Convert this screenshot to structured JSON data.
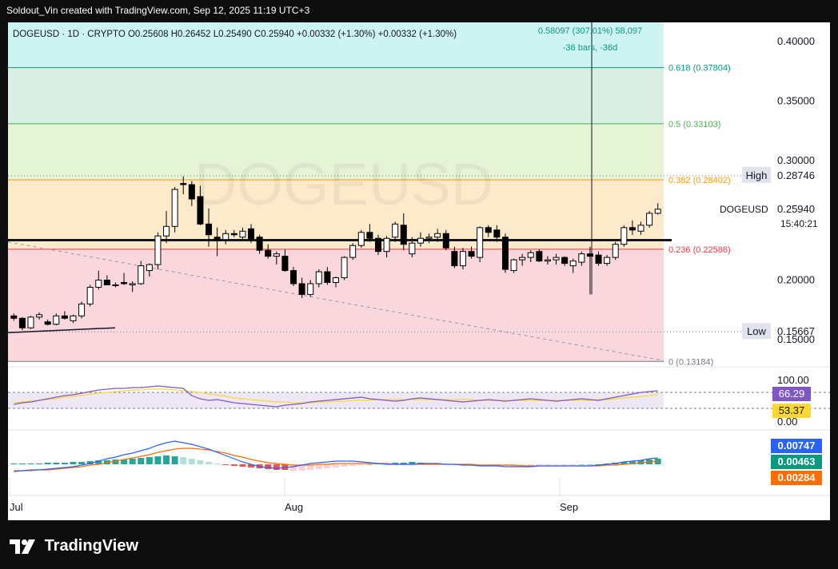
{
  "header": {
    "text": "Soldout_Vin created with TradingView.com, Sep 12, 2025 11:19 UTC+3"
  },
  "brand": {
    "text": "TradingView",
    "icon": "tradingview-logo-icon"
  },
  "chart_data": {
    "type": "candlestick",
    "symbol_line": "DOGEUSD · 1D · CRYPTO  O0.25608  H0.26452  L0.25490  C0.25940  +0.00332 (+1.30%)  +0.00332 (+1.30%)",
    "watermark": "DOGEUSD",
    "y_ticks": [
      "0.40000",
      "0.35000",
      "0.30000",
      "0.20000",
      "0.15000"
    ],
    "x_ticks": [
      "Jul",
      "Aug",
      "Sep"
    ],
    "ylim": [
      0.128,
      0.416
    ],
    "price_label": {
      "symbol": "DOGEUSD",
      "value": "0.25940",
      "countdown": "15:40:21"
    },
    "high_label": {
      "label": "High",
      "value": "0.28746"
    },
    "low_label": {
      "label": "Low",
      "value": "0.15667"
    },
    "measure": {
      "line1": "0.58097 (307.01%) 58,097",
      "line2": "-36 bars, -36d"
    },
    "fib_levels": [
      {
        "text": "0.618 (0.37804)",
        "price": 0.37804,
        "color": "#089981"
      },
      {
        "text": "0.5 (0.33103)",
        "price": 0.33103,
        "color": "#4caf50"
      },
      {
        "text": "0.382 (0.28402)",
        "price": 0.28402,
        "color": "#ff9800"
      },
      {
        "text": "0.236 (0.22586)",
        "price": 0.22586,
        "color": "#f23645"
      },
      {
        "text": "0 (0.13184)",
        "price": 0.13184,
        "color": "#787b86"
      }
    ],
    "candles": [
      [
        0.17,
        0.172,
        0.166,
        0.168
      ],
      [
        0.168,
        0.169,
        0.158,
        0.16
      ],
      [
        0.16,
        0.17,
        0.159,
        0.169
      ],
      [
        0.169,
        0.173,
        0.167,
        0.171
      ],
      [
        0.165,
        0.167,
        0.162,
        0.163
      ],
      [
        0.163,
        0.172,
        0.162,
        0.17
      ],
      [
        0.17,
        0.174,
        0.167,
        0.168
      ],
      [
        0.166,
        0.171,
        0.164,
        0.17
      ],
      [
        0.17,
        0.182,
        0.168,
        0.18
      ],
      [
        0.18,
        0.196,
        0.178,
        0.194
      ],
      [
        0.194,
        0.208,
        0.192,
        0.2
      ],
      [
        0.2,
        0.204,
        0.196,
        0.196
      ],
      [
        0.196,
        0.198,
        0.194,
        0.196
      ],
      [
        0.198,
        0.206,
        0.196,
        0.197
      ],
      [
        0.196,
        0.199,
        0.19,
        0.197
      ],
      [
        0.197,
        0.216,
        0.196,
        0.212
      ],
      [
        0.208,
        0.214,
        0.203,
        0.213
      ],
      [
        0.213,
        0.24,
        0.209,
        0.237
      ],
      [
        0.237,
        0.258,
        0.231,
        0.245
      ],
      [
        0.245,
        0.278,
        0.24,
        0.276
      ],
      [
        0.281,
        0.287,
        0.272,
        0.28
      ],
      [
        0.28,
        0.283,
        0.262,
        0.268
      ],
      [
        0.27,
        0.279,
        0.246,
        0.247
      ],
      [
        0.247,
        0.26,
        0.228,
        0.238
      ],
      [
        0.236,
        0.244,
        0.22,
        0.233
      ],
      [
        0.234,
        0.242,
        0.23,
        0.239
      ],
      [
        0.239,
        0.242,
        0.236,
        0.238
      ],
      [
        0.236,
        0.244,
        0.234,
        0.241
      ],
      [
        0.243,
        0.247,
        0.231,
        0.234
      ],
      [
        0.236,
        0.238,
        0.222,
        0.225
      ],
      [
        0.225,
        0.23,
        0.218,
        0.22
      ],
      [
        0.22,
        0.224,
        0.213,
        0.222
      ],
      [
        0.22,
        0.226,
        0.207,
        0.208
      ],
      [
        0.208,
        0.211,
        0.195,
        0.197
      ],
      [
        0.197,
        0.202,
        0.185,
        0.188
      ],
      [
        0.188,
        0.2,
        0.186,
        0.197
      ],
      [
        0.197,
        0.209,
        0.194,
        0.207
      ],
      [
        0.207,
        0.211,
        0.196,
        0.198
      ],
      [
        0.198,
        0.203,
        0.194,
        0.202
      ],
      [
        0.202,
        0.22,
        0.2,
        0.219
      ],
      [
        0.219,
        0.231,
        0.217,
        0.229
      ],
      [
        0.229,
        0.242,
        0.227,
        0.24
      ],
      [
        0.24,
        0.247,
        0.232,
        0.235
      ],
      [
        0.235,
        0.238,
        0.221,
        0.224
      ],
      [
        0.224,
        0.237,
        0.219,
        0.235
      ],
      [
        0.236,
        0.249,
        0.232,
        0.247
      ],
      [
        0.246,
        0.256,
        0.225,
        0.23
      ],
      [
        0.222,
        0.236,
        0.219,
        0.231
      ],
      [
        0.231,
        0.24,
        0.228,
        0.235
      ],
      [
        0.235,
        0.239,
        0.231,
        0.236
      ],
      [
        0.236,
        0.243,
        0.232,
        0.239
      ],
      [
        0.239,
        0.242,
        0.225,
        0.227
      ],
      [
        0.224,
        0.228,
        0.21,
        0.212
      ],
      [
        0.212,
        0.227,
        0.209,
        0.224
      ],
      [
        0.224,
        0.228,
        0.218,
        0.22
      ],
      [
        0.219,
        0.245,
        0.215,
        0.244
      ],
      [
        0.244,
        0.246,
        0.236,
        0.24
      ],
      [
        0.242,
        0.246,
        0.232,
        0.236
      ],
      [
        0.236,
        0.239,
        0.206,
        0.209
      ],
      [
        0.208,
        0.218,
        0.206,
        0.217
      ],
      [
        0.217,
        0.222,
        0.212,
        0.219
      ],
      [
        0.219,
        0.225,
        0.215,
        0.223
      ],
      [
        0.224,
        0.226,
        0.215,
        0.216
      ],
      [
        0.216,
        0.22,
        0.213,
        0.217
      ],
      [
        0.217,
        0.222,
        0.213,
        0.219
      ],
      [
        0.219,
        0.22,
        0.212,
        0.214
      ],
      [
        0.212,
        0.218,
        0.206,
        0.216
      ],
      [
        0.215,
        0.224,
        0.212,
        0.222
      ],
      [
        0.222,
        0.228,
        0.188,
        0.22
      ],
      [
        0.221,
        0.224,
        0.212,
        0.214
      ],
      [
        0.214,
        0.221,
        0.212,
        0.219
      ],
      [
        0.219,
        0.232,
        0.217,
        0.23
      ],
      [
        0.23,
        0.246,
        0.228,
        0.244
      ],
      [
        0.244,
        0.25,
        0.238,
        0.242
      ],
      [
        0.241,
        0.249,
        0.238,
        0.246
      ],
      [
        0.246,
        0.258,
        0.244,
        0.256
      ],
      [
        0.256,
        0.2645,
        0.2549,
        0.2594
      ]
    ],
    "rsi": {
      "values": [
        "66.29",
        "53.37"
      ],
      "colors": [
        "#7e57c2",
        "#fdd835"
      ],
      "ticks": [
        "100.00",
        "0.00"
      ]
    },
    "macd": {
      "values": [
        "0.00747",
        "0.00463",
        "0.00284"
      ],
      "colors": [
        "#2962ff",
        "#089981",
        "#ff6d00"
      ]
    },
    "colors": {
      "bull_body": "#ffffff",
      "bear_body": "#000000",
      "wick": "#000000",
      "text": "#131722",
      "grid": "#e0e3eb"
    }
  }
}
